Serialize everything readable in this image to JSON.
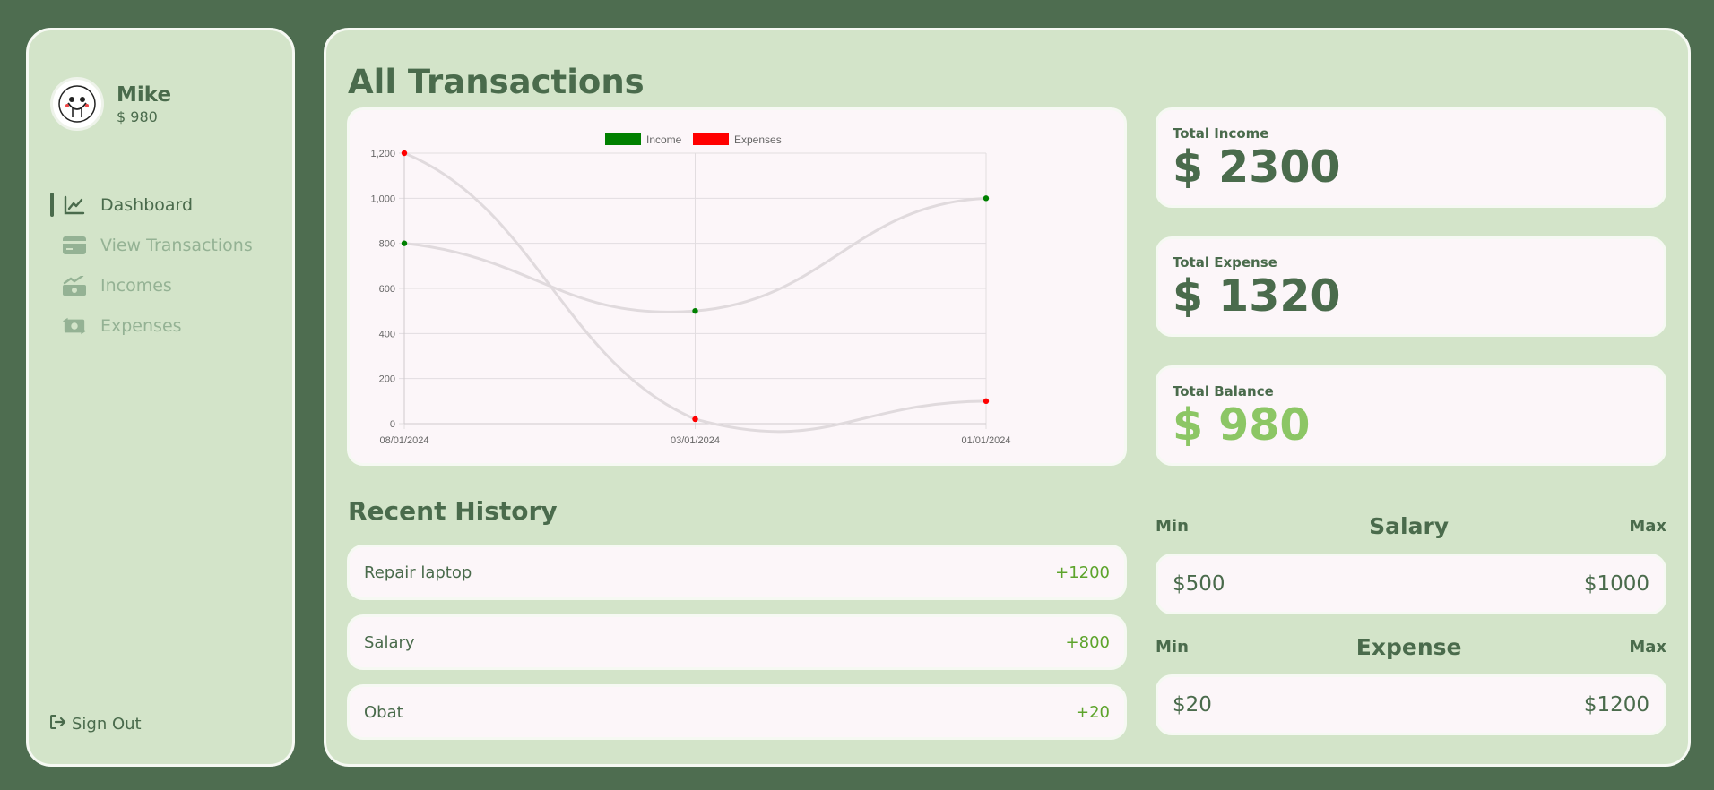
{
  "sidebar": {
    "user": {
      "name": "Mike",
      "balance": "$ 980"
    },
    "nav": [
      {
        "label": "Dashboard",
        "icon": "chart-line-icon",
        "active": true
      },
      {
        "label": "View Transactions",
        "icon": "credit-card-icon",
        "active": false
      },
      {
        "label": "Incomes",
        "icon": "money-bill-trend-up-icon",
        "active": false
      },
      {
        "label": "Expenses",
        "icon": "money-bill-transfer-icon",
        "active": false
      }
    ],
    "signout": "Sign Out"
  },
  "main": {
    "title": "All Transactions",
    "stats": [
      {
        "label": "Total Income",
        "value": "$ 2300"
      },
      {
        "label": "Total Expense",
        "value": "$ 1320"
      },
      {
        "label": "Total Balance",
        "value": "$ 980"
      }
    ],
    "history_title": "Recent History",
    "history": [
      {
        "name": "Repair laptop",
        "amount": "+1200"
      },
      {
        "name": "Salary",
        "amount": "+800"
      },
      {
        "name": "Obat",
        "amount": "+20"
      }
    ],
    "ranges": [
      {
        "title": "Salary",
        "min_label": "Min",
        "max_label": "Max",
        "min": "$500",
        "max": "$1000"
      },
      {
        "title": "Expense",
        "min_label": "Min",
        "max_label": "Max",
        "min": "$20",
        "max": "$1200"
      }
    ]
  },
  "colors": {
    "background": "#4e6d50",
    "panel": "#d3e4c9",
    "card": "#fcf6f9",
    "text": "#4a6b4c",
    "income": "#008000",
    "expense": "#ff0000",
    "positive": "#5da42c",
    "balance": "#8cc665"
  },
  "chart_data": {
    "type": "line",
    "categories": [
      "08/01/2024",
      "03/01/2024",
      "01/01/2024"
    ],
    "series": [
      {
        "name": "Income",
        "color": "#008000",
        "values": [
          800,
          500,
          1000
        ]
      },
      {
        "name": "Expenses",
        "color": "#ff0000",
        "values": [
          1200,
          20,
          100
        ]
      }
    ],
    "ylim": [
      0,
      1200
    ],
    "yticks": [
      0,
      200,
      400,
      600,
      800,
      1000,
      1200
    ],
    "yticklabels": [
      "0",
      "200",
      "400",
      "600",
      "800",
      "1,000",
      "1,200"
    ],
    "grid": true,
    "legend": "top-center",
    "smooth": true
  }
}
